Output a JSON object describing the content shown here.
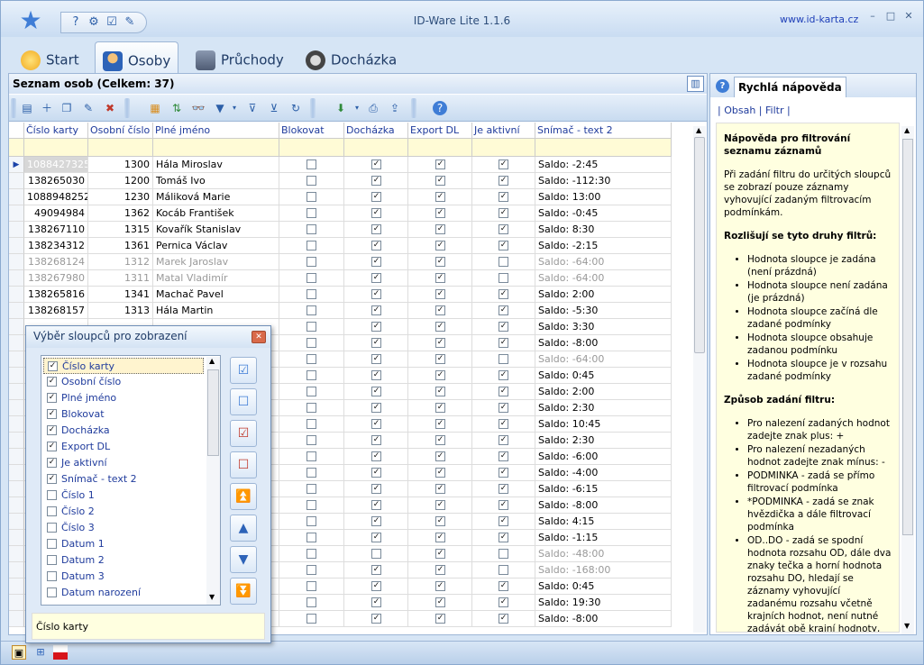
{
  "app": {
    "title": "ID-Ware Lite 1.1.6",
    "website": "www.id-karta.cz"
  },
  "ribbon": {
    "tabs": [
      {
        "label": "Start",
        "icon": "star-icon"
      },
      {
        "label": "Osoby",
        "icon": "person-icon"
      },
      {
        "label": "Průchody",
        "icon": "door-icon"
      },
      {
        "label": "Docházka",
        "icon": "clock-icon"
      }
    ],
    "active": "Osoby"
  },
  "list": {
    "title": "Seznam osob (Celkem: 37)"
  },
  "grid": {
    "columns": [
      "Číslo karty",
      "Osobní číslo",
      "Plné jméno",
      "Blokovat",
      "Docházka",
      "Export DL",
      "Je aktivní",
      "Snímač - text 2"
    ],
    "rows": [
      {
        "card": "1088427325",
        "pid": "1300",
        "name": "Hála Miroslav",
        "block": false,
        "att": true,
        "exp": true,
        "active": true,
        "saldo": "Saldo: -2:45",
        "gray": false,
        "current": true
      },
      {
        "card": "138265030",
        "pid": "1200",
        "name": "Tomáš Ivo",
        "block": false,
        "att": true,
        "exp": true,
        "active": true,
        "saldo": "Saldo: -112:30",
        "gray": false
      },
      {
        "card": "1088948252",
        "pid": "1230",
        "name": "Máliková Marie",
        "block": false,
        "att": true,
        "exp": true,
        "active": true,
        "saldo": "Saldo: 13:00",
        "gray": false
      },
      {
        "card": "49094984",
        "pid": "1362",
        "name": "Kocáb František",
        "block": false,
        "att": true,
        "exp": true,
        "active": true,
        "saldo": "Saldo: -0:45",
        "gray": false
      },
      {
        "card": "138267110",
        "pid": "1315",
        "name": "Kovařík Stanislav",
        "block": false,
        "att": true,
        "exp": true,
        "active": true,
        "saldo": "Saldo: 8:30",
        "gray": false
      },
      {
        "card": "138234312",
        "pid": "1361",
        "name": "Pernica Václav",
        "block": false,
        "att": true,
        "exp": true,
        "active": true,
        "saldo": "Saldo: -2:15",
        "gray": false
      },
      {
        "card": "138268124",
        "pid": "1312",
        "name": "Marek Jaroslav",
        "block": false,
        "att": true,
        "exp": true,
        "active": false,
        "saldo": "Saldo: -64:00",
        "gray": true
      },
      {
        "card": "138267980",
        "pid": "1311",
        "name": "Matal Vladimír",
        "block": false,
        "att": true,
        "exp": true,
        "active": false,
        "saldo": "Saldo: -64:00",
        "gray": true
      },
      {
        "card": "138265816",
        "pid": "1341",
        "name": "Machač Pavel",
        "block": false,
        "att": true,
        "exp": true,
        "active": true,
        "saldo": "Saldo: 2:00",
        "gray": false
      },
      {
        "card": "138268157",
        "pid": "1313",
        "name": "Hála Martin",
        "block": false,
        "att": true,
        "exp": true,
        "active": true,
        "saldo": "Saldo: -5:30",
        "gray": false
      },
      {
        "card": "",
        "pid": "",
        "name": "",
        "block": false,
        "att": true,
        "exp": true,
        "active": true,
        "saldo": "Saldo: 3:30",
        "gray": false
      },
      {
        "card": "",
        "pid": "",
        "name": "",
        "block": false,
        "att": true,
        "exp": true,
        "active": true,
        "saldo": "Saldo: -8:00",
        "gray": false
      },
      {
        "card": "",
        "pid": "",
        "name": "",
        "block": false,
        "att": true,
        "exp": true,
        "active": false,
        "saldo": "Saldo: -64:00",
        "gray": true
      },
      {
        "card": "",
        "pid": "",
        "name": "",
        "block": false,
        "att": true,
        "exp": true,
        "active": true,
        "saldo": "Saldo: 0:45",
        "gray": false
      },
      {
        "card": "",
        "pid": "",
        "name": "",
        "block": false,
        "att": true,
        "exp": true,
        "active": true,
        "saldo": "Saldo: 2:00",
        "gray": false
      },
      {
        "card": "",
        "pid": "",
        "name": "",
        "block": false,
        "att": true,
        "exp": true,
        "active": true,
        "saldo": "Saldo: 2:30",
        "gray": false
      },
      {
        "card": "",
        "pid": "",
        "name": "",
        "block": false,
        "att": true,
        "exp": true,
        "active": true,
        "saldo": "Saldo: 10:45",
        "gray": false
      },
      {
        "card": "",
        "pid": "",
        "name": "",
        "block": false,
        "att": true,
        "exp": true,
        "active": true,
        "saldo": "Saldo: 2:30",
        "gray": false
      },
      {
        "card": "",
        "pid": "",
        "name": "",
        "block": false,
        "att": true,
        "exp": true,
        "active": true,
        "saldo": "Saldo: -6:00",
        "gray": false
      },
      {
        "card": "",
        "pid": "",
        "name": "",
        "block": false,
        "att": true,
        "exp": true,
        "active": true,
        "saldo": "Saldo: -4:00",
        "gray": false
      },
      {
        "card": "",
        "pid": "",
        "name": "",
        "block": false,
        "att": true,
        "exp": true,
        "active": true,
        "saldo": "Saldo: -6:15",
        "gray": false
      },
      {
        "card": "",
        "pid": "",
        "name": "",
        "block": false,
        "att": true,
        "exp": true,
        "active": true,
        "saldo": "Saldo: -8:00",
        "gray": false
      },
      {
        "card": "",
        "pid": "",
        "name": "",
        "block": false,
        "att": true,
        "exp": true,
        "active": true,
        "saldo": "Saldo: 4:15",
        "gray": false
      },
      {
        "card": "",
        "pid": "",
        "name": "",
        "block": false,
        "att": true,
        "exp": true,
        "active": true,
        "saldo": "Saldo: -1:15",
        "gray": false
      },
      {
        "card": "",
        "pid": "",
        "name": "",
        "block": false,
        "att": false,
        "exp": true,
        "active": false,
        "saldo": "Saldo: -48:00",
        "gray": true
      },
      {
        "card": "",
        "pid": "",
        "name": "",
        "block": false,
        "att": true,
        "exp": true,
        "active": false,
        "saldo": "Saldo: -168:00",
        "gray": true
      },
      {
        "card": "",
        "pid": "",
        "name": "",
        "block": false,
        "att": true,
        "exp": true,
        "active": true,
        "saldo": "Saldo: 0:45",
        "gray": false
      },
      {
        "card": "",
        "pid": "",
        "name": "",
        "block": false,
        "att": true,
        "exp": true,
        "active": true,
        "saldo": "Saldo: 19:30",
        "gray": false
      },
      {
        "card": "",
        "pid": "",
        "name": "",
        "block": false,
        "att": true,
        "exp": true,
        "active": true,
        "saldo": "Saldo: -8:00",
        "gray": false
      }
    ]
  },
  "help": {
    "tab": "Rychlá nápověda",
    "links": [
      "| ",
      "Obsah",
      " | ",
      "Filtr",
      " |"
    ],
    "title": "Nápověda pro filtrování seznamu záznamů",
    "intro": "Při zadání filtru do určitých sloupců se zobrazí pouze záznamy vyhovující zadaným filtrovacím podmínkám.",
    "types_title": "Rozlišují se tyto druhy filtrů:",
    "types": [
      "Hodnota sloupce je zadána (není prázdná)",
      "Hodnota sloupce není zadána (je prázdná)",
      "Hodnota sloupce začíná dle zadané podmínky",
      "Hodnota sloupce obsahuje zadanou podmínku",
      "Hodnota sloupce je v rozsahu zadané podmínky"
    ],
    "entry_title": "Způsob zadání filtru:",
    "entry": [
      "Pro nalezení zadaných hodnot zadejte znak plus: +",
      "Pro nalezení nezadaných hodnot zadejte znak mínus: -",
      "PODMINKA - zadá se přímo filtrovací podmínka",
      "*PODMINKA - zadá se znak hvězdička a dále filtrovací podmínka",
      "OD..DO - zadá se spodní hodnota rozsahu OD, dále dva znaky tečka a horní hodnota rozsahu DO, hledají se záznamy vyhovující zadanému rozsahu včetně krajních hodnot, není nutné zadávát obě krajní hodnoty, např. pro vyfiltrování hodnot měnších"
    ]
  },
  "dialog": {
    "title": "Výběr sloupců pro zobrazení",
    "items": [
      {
        "label": "Číslo karty",
        "checked": true
      },
      {
        "label": "Osobní číslo",
        "checked": true
      },
      {
        "label": "Plné jméno",
        "checked": true
      },
      {
        "label": "Blokovat",
        "checked": true
      },
      {
        "label": "Docházka",
        "checked": true
      },
      {
        "label": "Export DL",
        "checked": true
      },
      {
        "label": "Je aktivní",
        "checked": true
      },
      {
        "label": "Snímač - text 2",
        "checked": true
      },
      {
        "label": "Číslo 1",
        "checked": false
      },
      {
        "label": "Číslo 2",
        "checked": false
      },
      {
        "label": "Číslo 3",
        "checked": false
      },
      {
        "label": "Datum 1",
        "checked": false
      },
      {
        "label": "Datum 2",
        "checked": false
      },
      {
        "label": "Datum 3",
        "checked": false
      },
      {
        "label": "Datum narození",
        "checked": false
      }
    ],
    "footer": "Číslo karty"
  }
}
